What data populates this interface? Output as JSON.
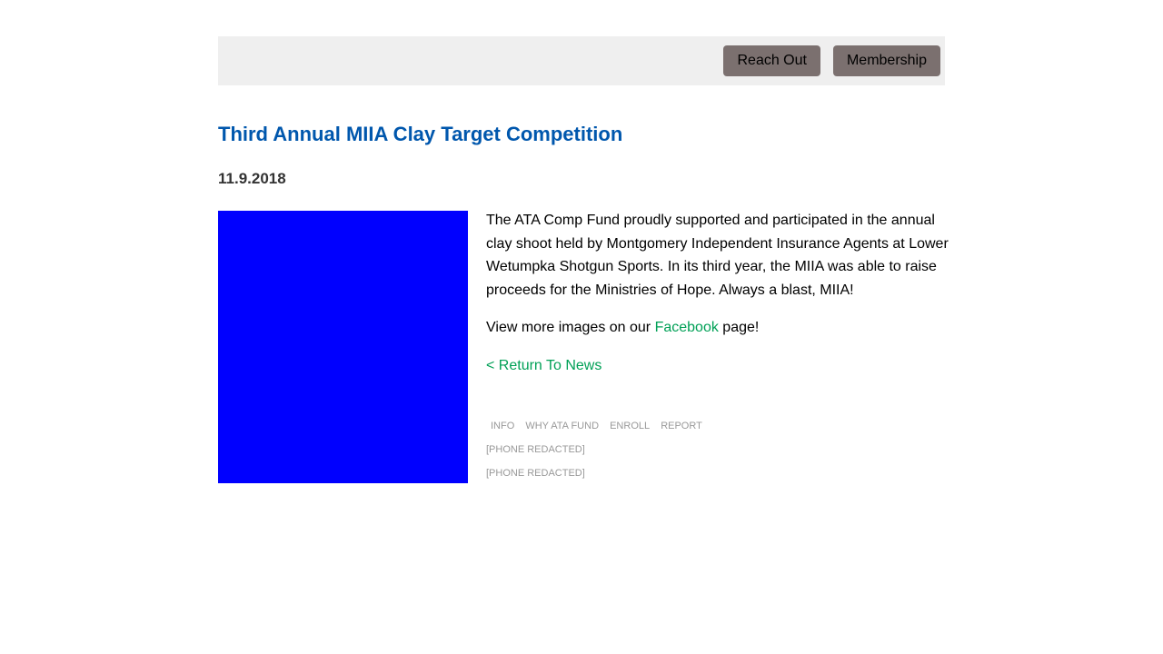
{
  "header": {
    "buttons": {
      "reach_out": "Reach Out",
      "membership": "Membership"
    }
  },
  "article": {
    "title": "Third Annual MIIA Clay Target Competition",
    "date": "11.9.2018",
    "paragraph": "The ATA Comp Fund proudly supported and participated in the annual clay shoot held by Montgomery Independent Insurance Agents at Lower Wetumpka Shotgun Sports. In its third year, the MIIA was able to raise proceeds for the Ministries of Hope. Always a blast, MIIA!",
    "more_prefix": "View more images on our ",
    "more_link": "Facebook",
    "more_suffix": " page!",
    "return_link": "< Return To News",
    "image_color": "#0000ff"
  },
  "footer": {
    "nav": [
      "INFO",
      "WHY ATA FUND",
      "ENROLL",
      "REPORT"
    ],
    "phone_1": "[PHONE REDACTED]",
    "phone_2": "[PHONE REDACTED]"
  },
  "colors": {
    "title": "#0057ad",
    "link": "#00a056",
    "button_bg": "#7b706f",
    "topbar_bg": "#efefef"
  }
}
